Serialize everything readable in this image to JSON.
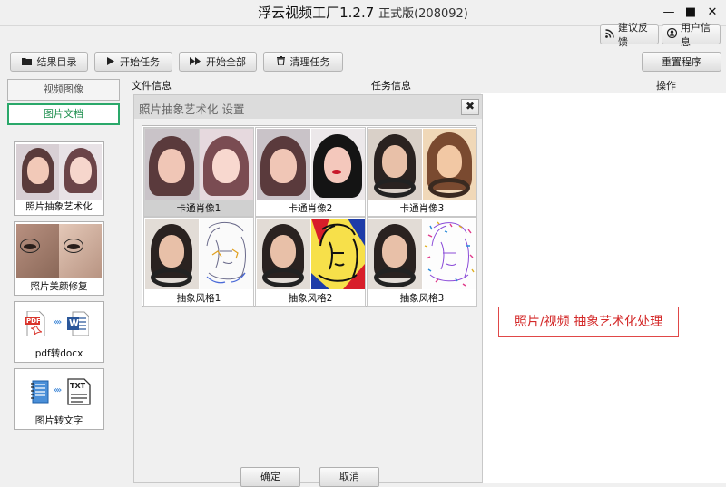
{
  "app": {
    "title": "浮云视频工厂1.2.7",
    "edition": "正式版(208092)"
  },
  "window_controls": {
    "minimize": "—",
    "maximize": "■",
    "close": "✕"
  },
  "top_right": {
    "feedback": "建议反馈",
    "user_info": "用户信息"
  },
  "toolbar": {
    "results_dir": "结果目录",
    "start_task": "开始任务",
    "start_all": "开始全部",
    "clear_tasks": "清理任务",
    "reset": "重置程序"
  },
  "sidebar": {
    "tab_video": "视频图像",
    "tab_image": "图片文档",
    "tools": [
      {
        "label": "照片抽象艺术化"
      },
      {
        "label": "照片美颜修复"
      },
      {
        "label": "pdf转docx"
      },
      {
        "label": "图片转文字"
      }
    ]
  },
  "columns": {
    "file_info": "文件信息",
    "task_info": "任务信息",
    "actions": "操作"
  },
  "dialog": {
    "title": "照片抽象艺术化 设置",
    "close": "✖",
    "styles": [
      {
        "label": "卡通肖像1",
        "selected": true
      },
      {
        "label": "卡通肖像2",
        "selected": false
      },
      {
        "label": "卡通肖像3",
        "selected": false
      },
      {
        "label": "抽象风格1",
        "selected": false
      },
      {
        "label": "抽象风格2",
        "selected": false
      },
      {
        "label": "抽象风格3",
        "selected": false
      }
    ],
    "confirm": "确定",
    "cancel": "取消"
  },
  "promo": {
    "text": "照片/视频 抽象艺术化处理"
  },
  "icons": {
    "pdf_text": "PDF",
    "word_text": "W",
    "txt_text": "TXT"
  },
  "colors": {
    "accent_green": "#2aa86a",
    "promo_red": "#d42a2a",
    "pdf_red": "#d9342b",
    "word_blue": "#2b579a"
  }
}
